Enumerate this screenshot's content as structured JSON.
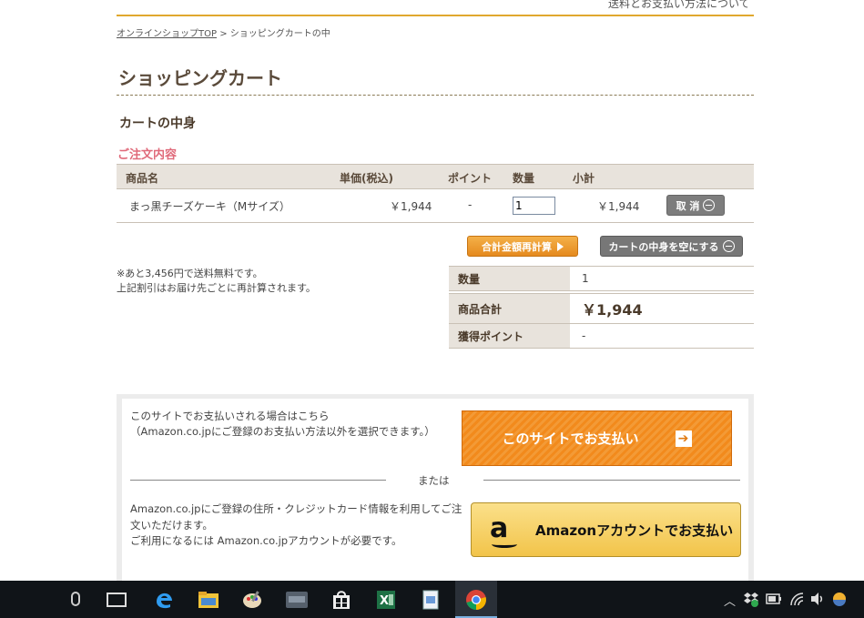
{
  "header": {
    "top_link": "送料とお支払い方法について"
  },
  "breadcrumb": {
    "home": "オンラインショップTOP",
    "separator": " > ",
    "current": "ショッピングカートの中"
  },
  "page_title": "ショッピングカート",
  "section_title": "カートの中身",
  "order_title": "ご注文内容",
  "cart_table": {
    "headers": {
      "name": "商品名",
      "price": "単価(税込)",
      "points": "ポイント",
      "qty": "数量",
      "subtotal": "小計"
    },
    "rows": [
      {
        "name": "まっ黒チーズケーキ（Mサイズ）",
        "price": "￥1,944",
        "points": "-",
        "qty": "1",
        "subtotal": "￥1,944",
        "cancel_label": "取 消"
      }
    ]
  },
  "buttons": {
    "recalc": "合計金額再計算",
    "empty_cart": "カートの中身を空にする"
  },
  "notes": {
    "line1": "※あと3,456円で送料無料です。",
    "line2": "上記割引はお届け先ごとに再計算されます。"
  },
  "summary": {
    "qty_label": "数量",
    "qty_value": "1",
    "total_label": "商品合計",
    "total_value": "￥1,944",
    "points_label": "獲得ポイント",
    "points_value": "-"
  },
  "payment": {
    "site_text_1": "このサイトでお支払いされる場合はこちら",
    "site_text_2": "（Amazon.co.jpにご登録のお支払い方法以外を選択できます。）",
    "site_button": "このサイトでお支払い",
    "or_text": "または",
    "amazon_text_1": "Amazon.co.jpにご登録の住所・クレジットカード情報を利用してご注文いただけます。",
    "amazon_text_2": "ご利用になるには Amazon.co.jpアカウントが必要です。",
    "amazon_button": "Amazonアカウントでお支払い"
  },
  "colors": {
    "accent_orange": "#f28a1c",
    "amazon_yellow": "#f2c44a",
    "heading_pink": "#e06a7a",
    "rule_gold": "#e0a82e"
  },
  "taskbar": {
    "icons": [
      "microphone-icon",
      "task-view-icon",
      "edge-icon",
      "file-explorer-icon",
      "paint-icon",
      "sirius-icon",
      "store-icon",
      "excel-icon",
      "document-viewer-icon",
      "chrome-icon"
    ],
    "tray_icons": [
      "chevron-up-icon",
      "dropbox-icon",
      "battery-icon",
      "wifi-icon",
      "volume-icon",
      "weather-icon"
    ]
  }
}
